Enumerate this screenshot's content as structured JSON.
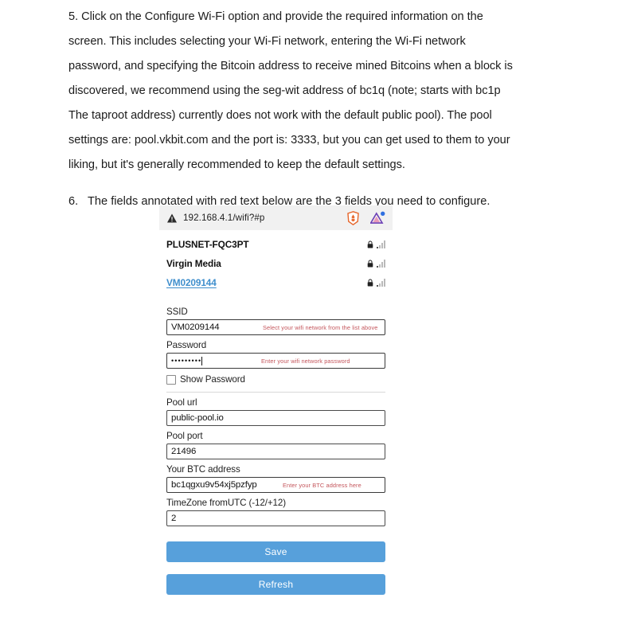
{
  "document": {
    "item5": {
      "number": "5.",
      "text": "Click on the Configure Wi-Fi option and provide the required information on the screen. This includes selecting your Wi-Fi network, entering the Wi-Fi network password, and specifying the Bitcoin address to receive mined Bitcoins when a block is discovered, we recommend using the seg-wit address of bc1q (note; starts with bc1p The taproot address) currently does not work with the default public pool). The pool settings are: pool.vkbit.com and the port is: 3333, but you can get used to them to your liking, but it's generally recommended to keep the default settings."
    },
    "item6": {
      "number": "6.",
      "text": "The fields annotated with red text below are the 3 fields you need to configure."
    }
  },
  "screenshot": {
    "urlbar": {
      "warning_icon": "warning-triangle-icon",
      "url": "192.168.4.1/wifi?#p",
      "brave_icon": "brave-shield-icon",
      "extension_icon": "triangle-extension-icon"
    },
    "networks": [
      {
        "ssid": "PLUSNET-FQC3PT",
        "secured": true,
        "selected": false
      },
      {
        "ssid": "Virgin Media",
        "secured": true,
        "selected": false
      },
      {
        "ssid": "VM0209144",
        "secured": true,
        "selected": true
      }
    ],
    "form": {
      "ssid": {
        "label": "SSID",
        "value": "VM0209144",
        "hint": "Select your wifi network from the list above"
      },
      "password": {
        "label": "Password",
        "value": "•••••••••",
        "hint": "Enter your wifi network password"
      },
      "show_password": {
        "label": "Show Password",
        "checked": false
      },
      "pool_url": {
        "label": "Pool url",
        "value": "public-pool.io"
      },
      "pool_port": {
        "label": "Pool port",
        "value": "21496"
      },
      "btc_address": {
        "label": "Your BTC address",
        "value": "bc1qgxu9v54xj5pzfyp",
        "hint": "Enter your BTC address here"
      },
      "timezone": {
        "label": "TimeZone fromUTC (-12/+12)",
        "value": "2"
      }
    },
    "buttons": {
      "save": "Save",
      "refresh": "Refresh"
    },
    "colors": {
      "button_blue": "#57a0db",
      "hint_red": "#c4565c",
      "link_blue": "#3e8ecc",
      "urlbar_bg": "#f1f1f1"
    }
  }
}
